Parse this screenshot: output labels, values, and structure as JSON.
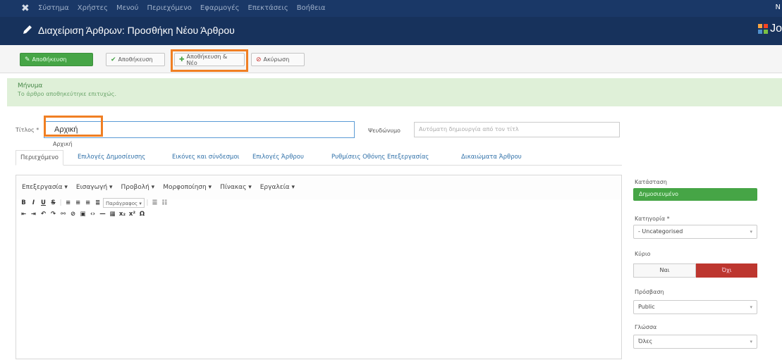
{
  "topbar": {
    "logo": "✖",
    "menu": [
      "Σύστημα",
      "Χρήστες",
      "Μενού",
      "Περιεχόμενο",
      "Εφαρμογές",
      "Επεκτάσεις",
      "Βοήθεια"
    ],
    "right": "Ν"
  },
  "header": {
    "title": "Διαχείριση Άρθρων: Προσθήκη Νέου Άρθρου",
    "logo_text": "Jo"
  },
  "toolbar": {
    "save_label": "Αποθήκευση",
    "save_close_label": "Αποθήκευση",
    "save_new_label": "Αποθήκευση & Νέο",
    "cancel_label": "Ακύρωση"
  },
  "message": {
    "heading": "Μήνυμα",
    "body": "Το άρθρο αποθηκεύτηκε επιτυχώς."
  },
  "form": {
    "title_label": "Τίτλος *",
    "title_value": "Αρχική",
    "alias_label": "Ψευδώνυμο",
    "alias_placeholder": "Αυτόματη δημιουργία από τον τίτλ",
    "suggestion": "Αρχική"
  },
  "tabs": [
    "Περιεχόμενο",
    "Επιλογές Δημοσίευσης",
    "Εικόνες και σύνδεσμοι",
    "Επιλογές Άρθρου",
    "Ρυθμίσεις Οθόνης Επεξεργασίας",
    "Δικαιώματα Άρθρου"
  ],
  "editor": {
    "menus": [
      "Επεξεργασία ▾",
      "Εισαγωγή ▾",
      "Προβολή ▾",
      "Μορφοποίηση ▾",
      "Πίνακας ▾",
      "Εργαλεία ▾"
    ],
    "paragraph_select": "Παράγραφος"
  },
  "sidebar": {
    "status_label": "Κατάσταση",
    "status_value": "Δημοσιευμένο",
    "category_label": "Κατηγορία *",
    "category_value": "- Uncategorised",
    "featured_label": "Κύριο",
    "featured_no": "Ναι",
    "featured_yes": "Όχι",
    "access_label": "Πρόσβαση",
    "access_value": "Public",
    "language_label": "Γλώσσα",
    "language_value": "Όλες"
  }
}
